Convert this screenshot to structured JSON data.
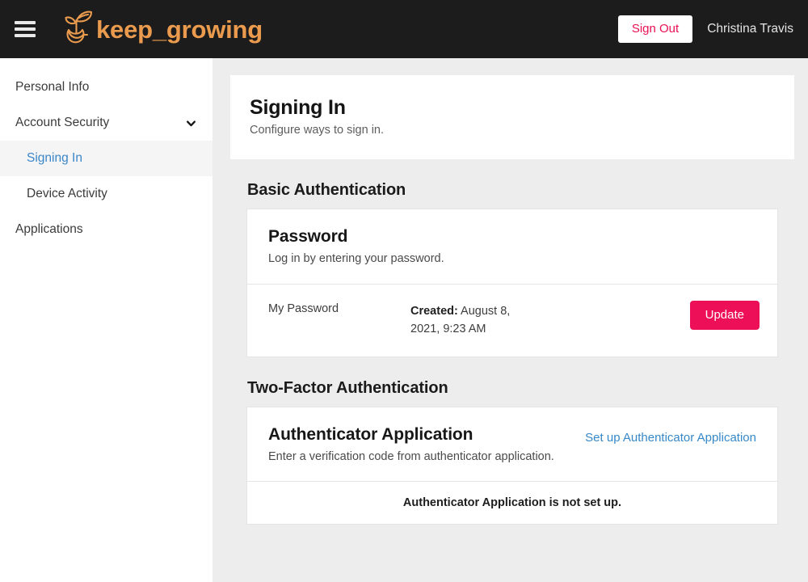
{
  "header": {
    "menu_icon": "hamburger-menu-icon",
    "logo_icon": "sprout-leaf-icon",
    "brand": "keep_growing",
    "signout_label": "Sign Out",
    "username": "Christina Travis",
    "background": "#1c1c1c",
    "brand_color": "#eb9b4e",
    "signout_color": "#e81153"
  },
  "sidebar": {
    "items": [
      {
        "label": "Personal Info",
        "level": "top",
        "active": false,
        "expandable": false
      },
      {
        "label": "Account Security",
        "level": "top",
        "active": false,
        "expandable": true,
        "chevron": "chevron-down-icon"
      },
      {
        "label": "Signing In",
        "level": "sub",
        "active": true,
        "expandable": false
      },
      {
        "label": "Device Activity",
        "level": "sub",
        "active": false,
        "expandable": false
      },
      {
        "label": "Applications",
        "level": "top",
        "active": false,
        "expandable": false
      }
    ],
    "active_color": "#3a86c8",
    "active_background": "#f5f5f5"
  },
  "page": {
    "title": "Signing In",
    "subtitle": "Configure ways to sign in."
  },
  "basic_auth": {
    "heading": "Basic Authentication",
    "password_card": {
      "title": "Password",
      "description": "Log in by entering your password.",
      "row": {
        "name": "My Password",
        "meta_label": "Created:",
        "meta_value": " August 8, 2021, 9:23 AM",
        "button_label": "Update",
        "button_color": "#ed0f57"
      }
    }
  },
  "two_factor": {
    "heading": "Two-Factor Authentication",
    "authenticator_card": {
      "title": "Authenticator Application",
      "description": "Enter a verification code from authenticator application.",
      "setup_link": "Set up Authenticator Application",
      "link_color": "#3788c8",
      "status": "Authenticator Application is not set up."
    }
  }
}
